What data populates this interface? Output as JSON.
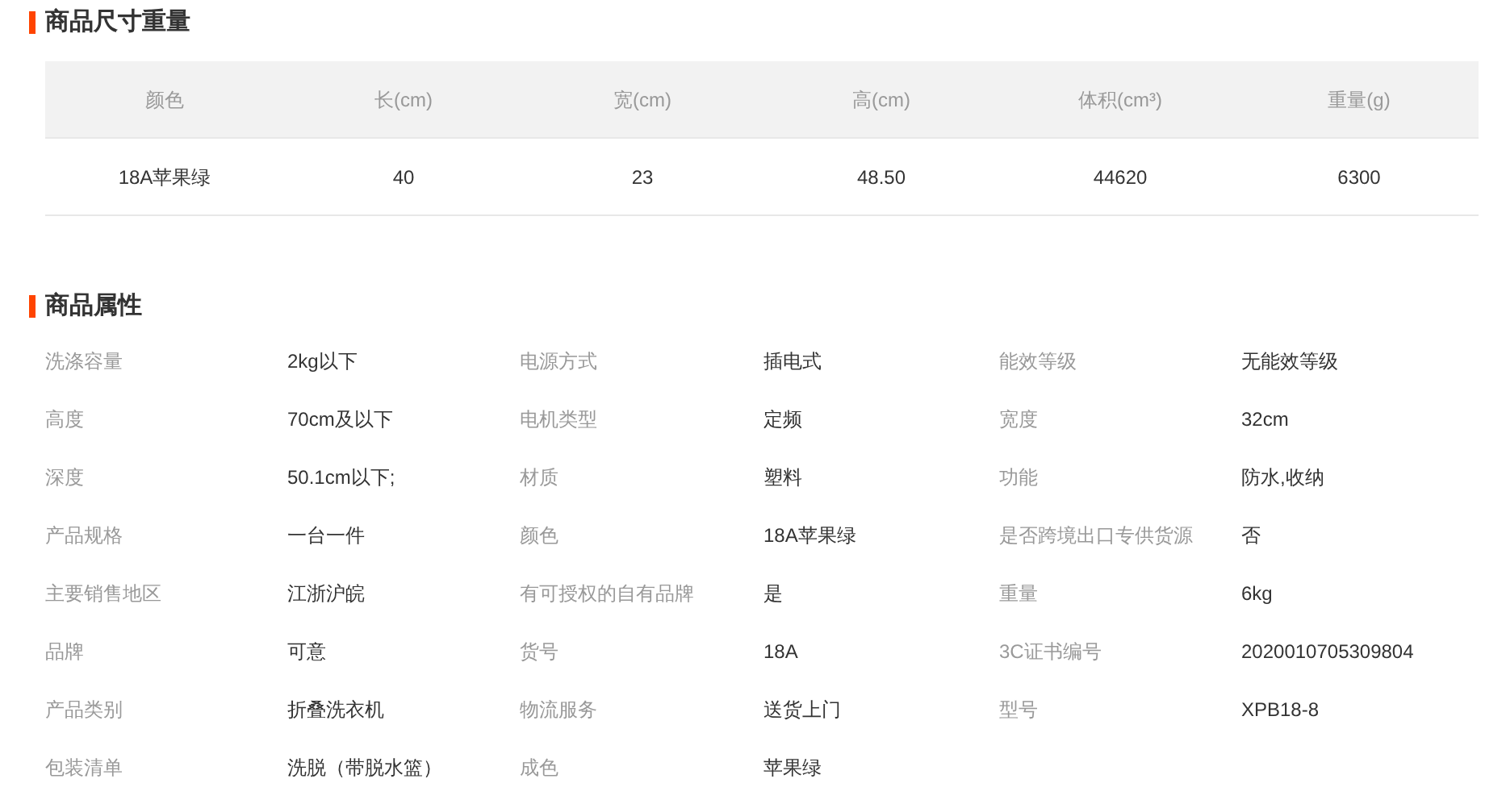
{
  "size_section": {
    "title": "商品尺寸重量",
    "table": {
      "columns": [
        "颜色",
        "长(cm)",
        "宽(cm)",
        "高(cm)",
        "体积(cm³)",
        "重量(g)"
      ],
      "rows": [
        [
          "18A苹果绿",
          "40",
          "23",
          "48.50",
          "44620",
          "6300"
        ]
      ]
    }
  },
  "attributes_section": {
    "title": "商品属性",
    "attributes": [
      {
        "label": "洗涤容量",
        "value": "2kg以下"
      },
      {
        "label": "电源方式",
        "value": "插电式"
      },
      {
        "label": "能效等级",
        "value": "无能效等级"
      },
      {
        "label": "高度",
        "value": "70cm及以下"
      },
      {
        "label": "电机类型",
        "value": "定频"
      },
      {
        "label": "宽度",
        "value": "32cm"
      },
      {
        "label": "深度",
        "value": "50.1cm以下;"
      },
      {
        "label": "材质",
        "value": "塑料"
      },
      {
        "label": "功能",
        "value": "防水,收纳"
      },
      {
        "label": "产品规格",
        "value": "一台一件"
      },
      {
        "label": "颜色",
        "value": "18A苹果绿"
      },
      {
        "label": "是否跨境出口专供货源",
        "value": "否"
      },
      {
        "label": "主要销售地区",
        "value": "江浙沪皖"
      },
      {
        "label": "有可授权的自有品牌",
        "value": "是"
      },
      {
        "label": "重量",
        "value": "6kg"
      },
      {
        "label": "品牌",
        "value": "可意"
      },
      {
        "label": "货号",
        "value": "18A"
      },
      {
        "label": "3C证书编号",
        "value": "2020010705309804"
      },
      {
        "label": "产品类别",
        "value": "折叠洗衣机"
      },
      {
        "label": "物流服务",
        "value": "送货上门"
      },
      {
        "label": "型号",
        "value": "XPB18-8"
      },
      {
        "label": "包装清单",
        "value": "洗脱（带脱水篮）"
      },
      {
        "label": "成色",
        "value": "苹果绿"
      }
    ]
  }
}
